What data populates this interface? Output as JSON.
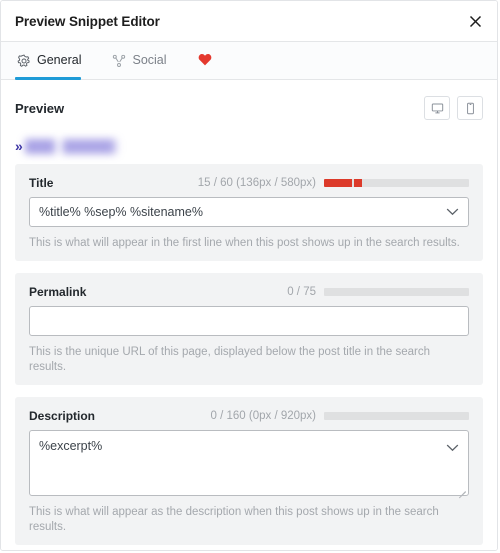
{
  "header": {
    "title": "Preview Snippet Editor",
    "close_label": "×"
  },
  "tabs": [
    {
      "label": "General",
      "icon": "gear-icon",
      "active": true
    },
    {
      "label": "Social",
      "icon": "share-nodes-icon",
      "active": false
    },
    {
      "label": "",
      "icon": "heart-icon",
      "active": false
    }
  ],
  "preview": {
    "title": "Preview",
    "devices": [
      {
        "name": "desktop",
        "icon": "desktop-monitor-icon",
        "selected": true
      },
      {
        "name": "mobile",
        "icon": "mobile-phone-icon",
        "selected": false
      }
    ],
    "snippet_marker": "»",
    "snippet_title_blurred": ""
  },
  "fields": {
    "title": {
      "label": "Title",
      "counter": "15 / 60 (136px / 580px)",
      "value": "%title% %sep% %sitename%",
      "placeholder": "",
      "help": "This is what will appear in the first line when this post shows up in the search results.",
      "progress_color": "#dc3a2a",
      "progress_segments": [
        {
          "left_pct": 0,
          "width_pct": 19
        },
        {
          "left_pct": 20.5,
          "width_pct": 5.5
        }
      ]
    },
    "permalink": {
      "label": "Permalink",
      "counter": "0 / 75",
      "value": "",
      "placeholder": "",
      "help": "This is the unique URL of this page, displayed below the post title in the search results.",
      "progress_color": "#dc3a2a",
      "progress_segments": []
    },
    "description": {
      "label": "Description",
      "counter": "0 / 160 (0px / 920px)",
      "value": "%excerpt%",
      "placeholder": "",
      "help": "This is what will appear as the description when this post shows up in the search results.",
      "progress_color": "#dc3a2a",
      "progress_segments": []
    }
  },
  "colors": {
    "accent_tab": "#1e9bd7",
    "heart": "#e4392e",
    "panel_bg": "#f2f3f4",
    "progress_track": "#dfe0e1",
    "snippet_link": "#3b33a3"
  }
}
